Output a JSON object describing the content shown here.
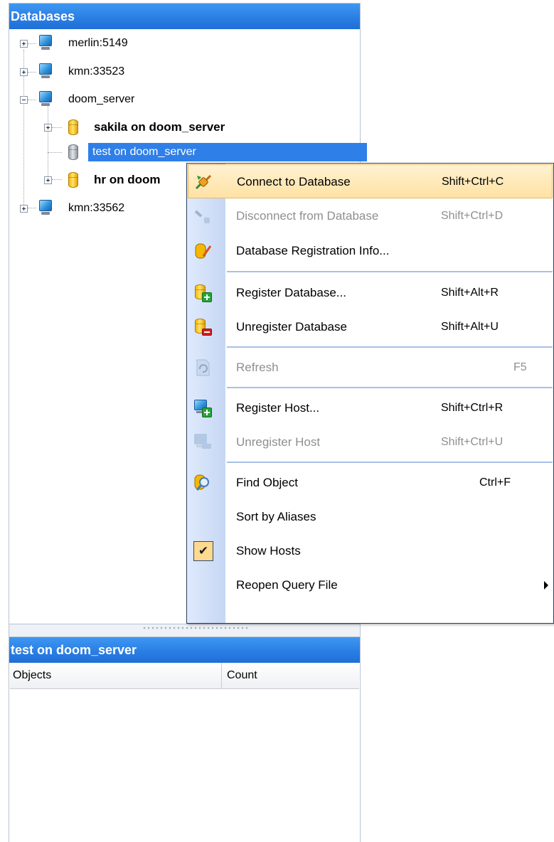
{
  "databases_panel": {
    "title": "Databases",
    "tree": [
      {
        "label": "merlin:5149",
        "type": "host",
        "expander": "plus"
      },
      {
        "label": "kmn:33523",
        "type": "host",
        "expander": "plus"
      },
      {
        "label": "doom_server",
        "type": "host",
        "expander": "minus"
      },
      {
        "label": "sakila on doom_server",
        "type": "database",
        "expander": "plus",
        "bold": true
      },
      {
        "label": "test on doom_server",
        "type": "database-disconnected",
        "selected": true
      },
      {
        "label": "hr on doom",
        "type": "database",
        "expander": "plus",
        "bold": true
      },
      {
        "label": "kmn:33562",
        "type": "host",
        "expander": "plus"
      }
    ]
  },
  "context_menu": {
    "items": [
      {
        "label": "Connect to Database",
        "shortcut": "Shift+Ctrl+C",
        "icon": "connect-plug-icon",
        "state": "highlighted"
      },
      {
        "label": "Disconnect from Database",
        "shortcut": "Shift+Ctrl+D",
        "icon": "disconnect-plug-icon",
        "state": "disabled"
      },
      {
        "label": "Database Registration Info...",
        "shortcut": "",
        "icon": "database-edit-icon",
        "state": "enabled"
      },
      {
        "label": "Register Database...",
        "shortcut": "Shift+Alt+R",
        "icon": "database-add-icon",
        "state": "enabled"
      },
      {
        "label": "Unregister Database",
        "shortcut": "Shift+Alt+U",
        "icon": "database-remove-icon",
        "state": "enabled"
      },
      {
        "label": "Refresh",
        "shortcut": "F5",
        "icon": "refresh-icon",
        "state": "disabled"
      },
      {
        "label": "Register Host...",
        "shortcut": "Shift+Ctrl+R",
        "icon": "host-add-icon",
        "state": "enabled"
      },
      {
        "label": "Unregister Host",
        "shortcut": "Shift+Ctrl+U",
        "icon": "host-remove-icon",
        "state": "disabled"
      },
      {
        "label": "Find Object",
        "shortcut": "Ctrl+F",
        "icon": "find-object-icon",
        "state": "enabled"
      },
      {
        "label": "Sort by Aliases",
        "shortcut": "",
        "icon": "",
        "state": "enabled"
      },
      {
        "label": "Show Hosts",
        "shortcut": "",
        "icon": "checkmark-icon",
        "state": "checked"
      },
      {
        "label": "Reopen Query File",
        "shortcut": "",
        "icon": "submenu-arrow-icon",
        "state": "submenu"
      }
    ]
  },
  "details_panel": {
    "title": "test on doom_server",
    "columns": [
      "Objects",
      "Count"
    ]
  },
  "colors": {
    "header_blue": "#2b7fe4",
    "selection_blue": "#2f7fe8",
    "menu_highlight": "#ffe1a4",
    "disabled_text": "#8f8f8f"
  }
}
